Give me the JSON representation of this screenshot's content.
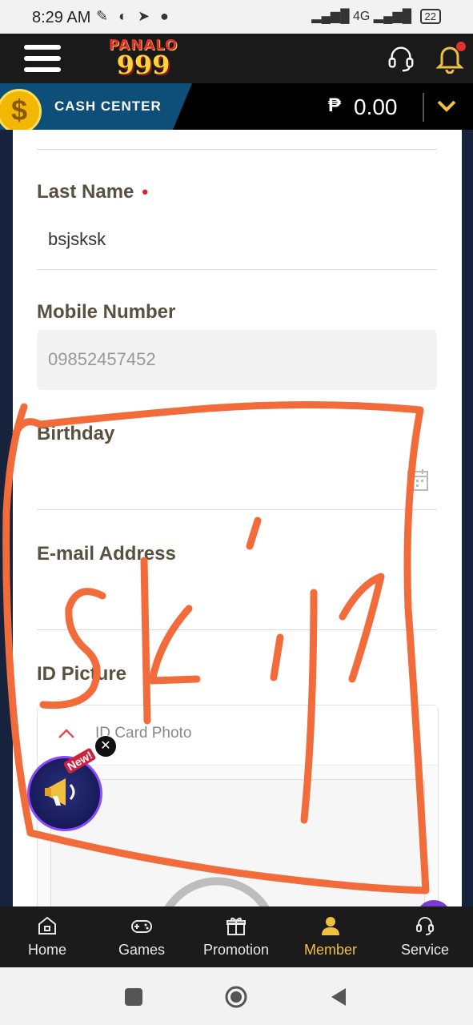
{
  "status_bar": {
    "time": "8:29 AM",
    "battery": "22",
    "network": "4G"
  },
  "header": {
    "logo_top": "PANALO",
    "logo_num": "999"
  },
  "cash_center": {
    "label": "CASH CENTER",
    "currency": "₱",
    "balance": "0.00"
  },
  "form": {
    "last_name": {
      "label": "Last Name",
      "required_mark": "•",
      "value": "bsjsksk"
    },
    "mobile": {
      "label": "Mobile Number",
      "value": "09852457452"
    },
    "birthday": {
      "label": "Birthday",
      "value": ""
    },
    "email": {
      "label": "E-mail Address",
      "value": ""
    },
    "id_picture": {
      "label": "ID Picture",
      "card_title": "ID Card Photo"
    }
  },
  "promo": {
    "badge": "New!",
    "close": "✕"
  },
  "tabs": [
    {
      "label": "Home",
      "icon": "home-icon"
    },
    {
      "label": "Games",
      "icon": "gamepad-icon"
    },
    {
      "label": "Promotion",
      "icon": "gift-icon"
    },
    {
      "label": "Member",
      "icon": "user-icon"
    },
    {
      "label": "Service",
      "icon": "headset-icon"
    }
  ],
  "colors": {
    "accent": "#f0c040",
    "required": "#dd2222",
    "annotation": "#f26b3a"
  }
}
